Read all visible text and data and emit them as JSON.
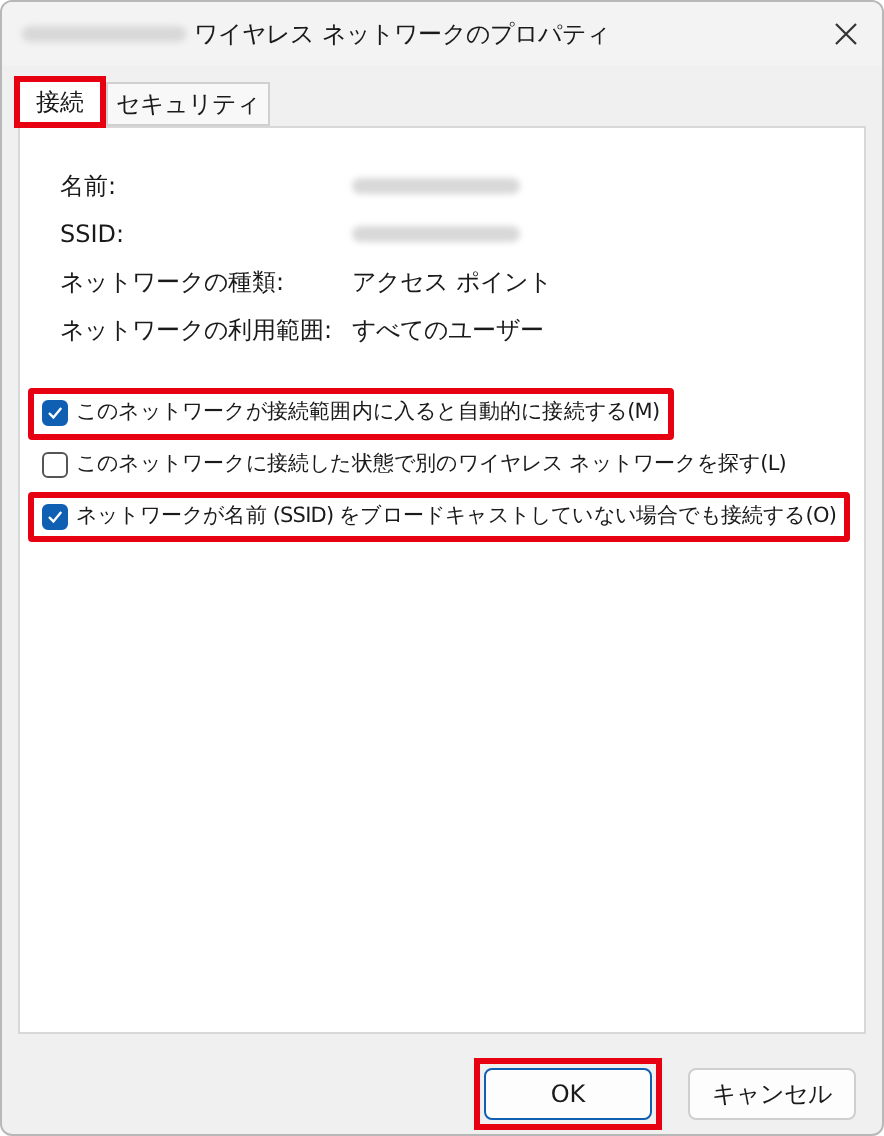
{
  "window": {
    "title": "ワイヤレス ネットワークのプロパティ",
    "title_redacted": true
  },
  "tabs": [
    {
      "label": "接続",
      "selected": true,
      "highlighted": true
    },
    {
      "label": "セキュリティ",
      "selected": false,
      "highlighted": false
    }
  ],
  "properties": [
    {
      "label": "名前:",
      "redacted": true
    },
    {
      "label": "SSID:",
      "redacted": true
    },
    {
      "label": "ネットワークの種類:",
      "value": "アクセス ポイント",
      "redacted": false
    },
    {
      "label": "ネットワークの利用範囲:",
      "value": "すべてのユーザー",
      "redacted": false
    }
  ],
  "options": [
    {
      "label": "このネットワークが接続範囲内に入ると自動的に接続する(M)",
      "checked": true,
      "highlighted": true
    },
    {
      "label": "このネットワークに接続した状態で別のワイヤレス ネットワークを探す(L)",
      "checked": false,
      "highlighted": false
    },
    {
      "label": "ネットワークが名前 (SSID) をブロードキャストしていない場合でも接続する(O)",
      "checked": true,
      "highlighted": true
    }
  ],
  "buttons": [
    {
      "label": "OK",
      "default": true,
      "highlighted": true
    },
    {
      "label": "キャンセル",
      "default": false,
      "highlighted": false
    }
  ]
}
